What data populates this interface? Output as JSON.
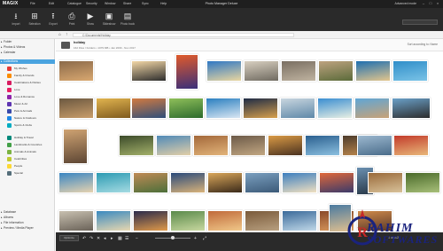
{
  "app": {
    "logo": "MAGIX",
    "title": "Photo Manager Deluxe",
    "menu": [
      "File",
      "Edit",
      "Catalogue",
      "Security",
      "Window",
      "Share",
      "Sync",
      "Help"
    ],
    "advanced": "Advanced mode"
  },
  "toolbar": {
    "buttons": [
      {
        "label": "Import",
        "icon": "download-icon"
      },
      {
        "label": "Selection",
        "icon": "selection-icon"
      },
      {
        "label": "Export",
        "icon": "upload-icon"
      },
      {
        "label": "Print",
        "icon": "print-icon"
      },
      {
        "label": "Show",
        "icon": "play-icon"
      },
      {
        "label": "Slideshow",
        "icon": "slideshow-icon"
      },
      {
        "label": "Photo book",
        "icon": "photobook-icon"
      }
    ]
  },
  "path": {
    "value": "C:\\Documents\\Holiday"
  },
  "sidebar": {
    "sections": [
      "Folder",
      "Photos & Videos",
      "Calendar",
      "Collections"
    ],
    "selected": "Collections",
    "items": [
      {
        "label": "My Wishes",
        "color": "#e53935"
      },
      {
        "label": "Family & Friends",
        "color": "#fb8c00"
      },
      {
        "label": "Celebrations & Parties",
        "color": "#d81b60"
      },
      {
        "label": "Love",
        "color": "#e91e63"
      },
      {
        "label": "Love & Romance",
        "color": "#8e24aa"
      },
      {
        "label": "Music & Art",
        "color": "#5e35b1"
      },
      {
        "label": "Pets & Animals",
        "color": "#3949ab"
      },
      {
        "label": "Nature & Outdoors",
        "color": "#1e88e5"
      },
      {
        "label": "Sports & Clubs",
        "color": "#00acc1"
      },
      {
        "label": "Holiday & Travel",
        "color": "#00897b"
      },
      {
        "label": "Landmarks & Countries",
        "color": "#43a047"
      },
      {
        "label": "Animals & Animals",
        "color": "#7cb342"
      },
      {
        "label": "Celebrities",
        "color": "#c0ca33"
      },
      {
        "label": "People",
        "color": "#fdd835"
      },
      {
        "label": "Special",
        "color": "#546e7a"
      }
    ],
    "bottom_sections": [
      "Database",
      "Albums",
      "File information",
      "Preview / Media Player"
    ]
  },
  "album": {
    "name": "holiday",
    "meta": "162 Files / Folders • 1079 MB • Jan 2009 - Nov 2017",
    "sort": "Sort according to: Name"
  },
  "bottombar": {
    "options_label": "Optimize",
    "count": "1 of 162"
  },
  "watermark": {
    "line1": "RAHIM",
    "line2": "SOFTWARES"
  },
  "colors": {
    "toolbar_bg": "#2a2a2a",
    "selection_blue": "#4aa3df",
    "watermark_blue": "#1a237e",
    "watermark_red": "#c62828"
  },
  "thumbnails": [
    {
      "c1": "#8b6a4a",
      "c2": "#d9a870"
    },
    {
      "c1": "#f3d7a6",
      "c2": "#2d2d2d"
    },
    {
      "c1": "#e05a2b",
      "c2": "#3a2f7a"
    },
    {
      "c1": "#2f78c4",
      "c2": "#e9d6a0"
    },
    {
      "c1": "#d8cfc0",
      "c2": "#6f6a60"
    },
    {
      "c1": "#7a6f62",
      "c2": "#bfb3a0"
    },
    {
      "c1": "#bda27f",
      "c2": "#5b6b3a"
    },
    {
      "c1": "#1d6fb0",
      "c2": "#e3c68d"
    },
    {
      "c1": "#2f8ec9",
      "c2": "#7bc3e6"
    },
    {
      "c1": "#6b5840",
      "c2": "#c99d6a"
    },
    {
      "c1": "#e1b44f",
      "c2": "#7f5a1e"
    },
    {
      "c1": "#d27a40",
      "c2": "#2f4f7a"
    },
    {
      "c1": "#8fbf5a",
      "c2": "#2c6a2c"
    },
    {
      "c1": "#2a7fc0",
      "c2": "#d8e6f2"
    },
    {
      "c1": "#1e2b45",
      "c2": "#d7a04d"
    },
    {
      "c1": "#c9d6df",
      "c2": "#5e88a8"
    },
    {
      "c1": "#3a8ed1",
      "c2": "#e7efe3"
    },
    {
      "c1": "#5fa6d6",
      "c2": "#c8a276"
    },
    {
      "c1": "#6aa0c8",
      "c2": "#2c2c2c"
    },
    {
      "c1": "#cfa372",
      "c2": "#5d4634"
    },
    {
      "c1": "#3b4a2a",
      "c2": "#a3b06a"
    },
    {
      "c1": "#4f8ab8",
      "c2": "#e2cfa8"
    },
    {
      "c1": "#a3683a",
      "c2": "#e2b47a"
    },
    {
      "c1": "#6c5a48",
      "c2": "#c2a782"
    },
    {
      "c1": "#d99a45",
      "c2": "#4a3220"
    },
    {
      "c1": "#2a5f8f",
      "c2": "#8cc0e0"
    },
    {
      "c1": "#4c3b2b",
      "c2": "#c48d4f"
    },
    {
      "c1": "#9cb8cf",
      "c2": "#4a6c8a"
    },
    {
      "c1": "#c23a2a",
      "c2": "#e8b77a"
    },
    {
      "c1": "#3a86c2",
      "c2": "#e6d3b0"
    },
    {
      "c1": "#2c9bb3",
      "c2": "#a5dbe2"
    },
    {
      "c1": "#bf8a55",
      "c2": "#4c6f3a"
    },
    {
      "c1": "#2a4a7a",
      "c2": "#d9b37a"
    },
    {
      "c1": "#d9a65a",
      "c2": "#3a2a1a"
    },
    {
      "c1": "#7a9fbf",
      "c2": "#3c5a78"
    },
    {
      "c1": "#3d7fbf",
      "c2": "#f0e0c0"
    },
    {
      "c1": "#e0683a",
      "c2": "#3a3a6a"
    },
    {
      "c1": "#6a8fb0",
      "c2": "#2a3a4a"
    },
    {
      "c1": "#9a6a3a",
      "c2": "#d8c29a"
    },
    {
      "c1": "#4a6a2a",
      "c2": "#a8c07a"
    },
    {
      "c1": "#c8c0b0",
      "c2": "#6a6258"
    },
    {
      "c1": "#3a8ac0",
      "c2": "#e8d8b0"
    },
    {
      "c1": "#2a2a4a",
      "c2": "#e09a4a"
    },
    {
      "c1": "#5a8a4a",
      "c2": "#c8d8a0"
    },
    {
      "c1": "#c06a3a",
      "c2": "#f0c88a"
    },
    {
      "c1": "#7a5a3a",
      "c2": "#b8a080"
    },
    {
      "c1": "#3a6a9a",
      "c2": "#c0d8e8"
    },
    {
      "c1": "#8a4a2a",
      "c2": "#e0a060"
    },
    {
      "c1": "#4a7aa0",
      "c2": "#e0c090"
    },
    {
      "c1": "#d08a4a",
      "c2": "#5a3a2a"
    }
  ]
}
